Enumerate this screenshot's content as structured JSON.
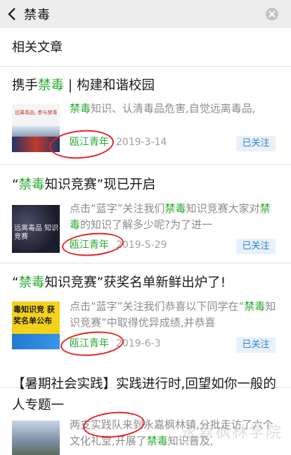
{
  "header": {
    "search_query": "禁毒"
  },
  "section": {
    "title": "相关文章"
  },
  "articles": [
    {
      "title_prefix": "携手",
      "title_highlight": "禁毒",
      "title_suffix": " | 构建和谐校园",
      "snippet_highlight": "禁毒",
      "snippet_rest": "知识、认清毒品危害,自觉远离毒品,",
      "source": "瓯江青年",
      "date": "2019-3-14",
      "follow_label": "已关注",
      "thumb_text": "远离毒品, 参与禁毒"
    },
    {
      "title_prefix": "“",
      "title_highlight": "禁毒",
      "title_suffix": "知识竞赛”现已开启",
      "snippet_a": "点击“蓝字”关注我们",
      "snippet_highlight": "禁毒",
      "snippet_b": "知识竞赛大家对",
      "snippet_highlight2": "禁毒",
      "snippet_c": "的知识了解多少呢?为了进一",
      "source": "瓯江青年",
      "date": "2019-5-29",
      "follow_label": "已关注",
      "thumb_text": "远离毒品 知识竞赛"
    },
    {
      "title_prefix": "“",
      "title_highlight": "禁毒",
      "title_suffix": "知识竞赛”获奖名单新鲜出炉了!",
      "snippet_a": "点击“蓝字”关注我们恭喜以下同学在“",
      "snippet_highlight": "禁毒",
      "snippet_b": "知识竞赛”中取得优异成绩,并恭喜",
      "source": "瓯江青年",
      "date": "2019-6-3",
      "follow_label": "已关注",
      "thumb_text": "毒知识竞 获奖名单公布"
    },
    {
      "title": "【暑期社会实践】实践进行时,回望如你一般的人专题一",
      "snippet_a": "两支实践队来到永嘉枫林镇,分批走访了六个文化礼堂,开展了",
      "snippet_highlight": "禁毒",
      "snippet_b": "知识普及,"
    }
  ],
  "watermark": "永嘉枫林学院"
}
